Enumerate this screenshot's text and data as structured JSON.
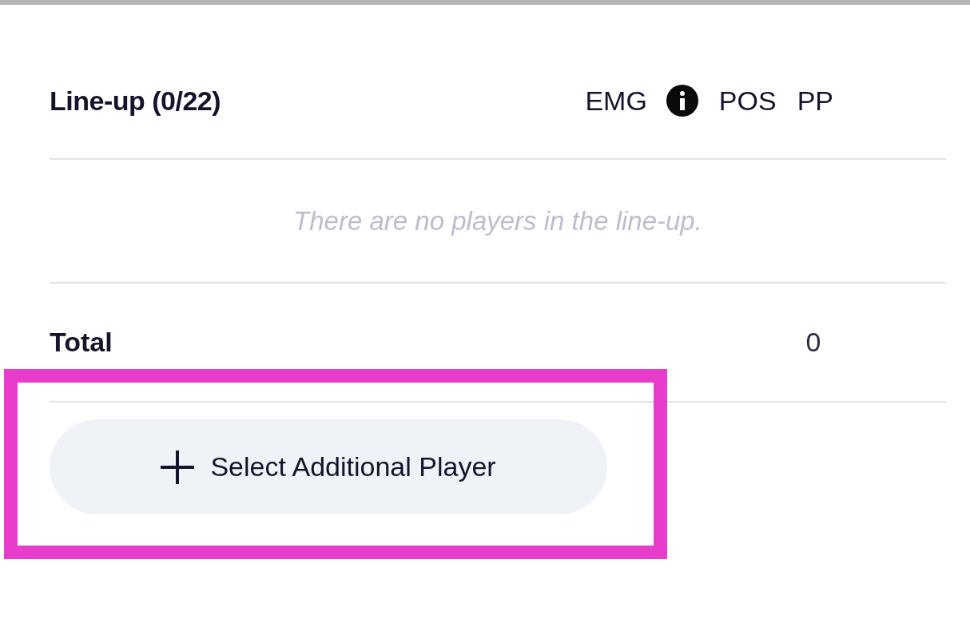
{
  "lineup": {
    "title": "Line-up (0/22)",
    "columns": [
      {
        "label": "EMG",
        "info": true
      },
      {
        "label": "POS",
        "info": false
      },
      {
        "label": "PP",
        "info": false
      }
    ],
    "empty_message": "There are no players in the line-up.",
    "total": {
      "label": "Total",
      "value": "0"
    },
    "add_button": {
      "label": "Select Additional Player",
      "highlighted": true
    }
  }
}
